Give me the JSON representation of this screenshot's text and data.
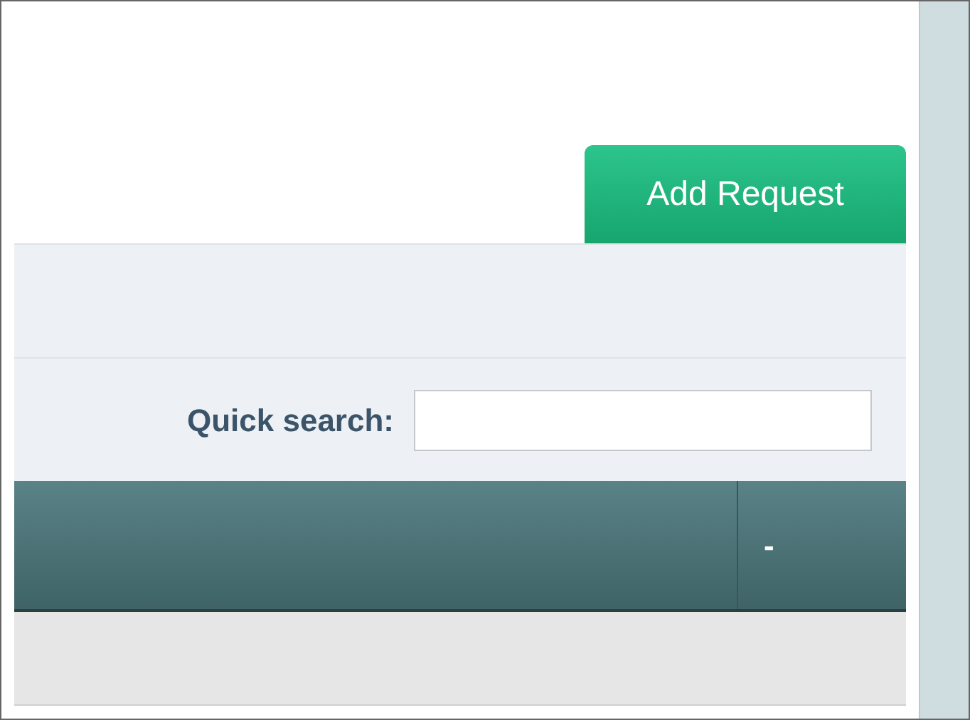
{
  "header": {
    "add_button": "Add Request"
  },
  "filter_bar": {
    "search_label": "Quick search:"
  },
  "table": {
    "columns": [
      {
        "label": "-"
      }
    ]
  }
}
